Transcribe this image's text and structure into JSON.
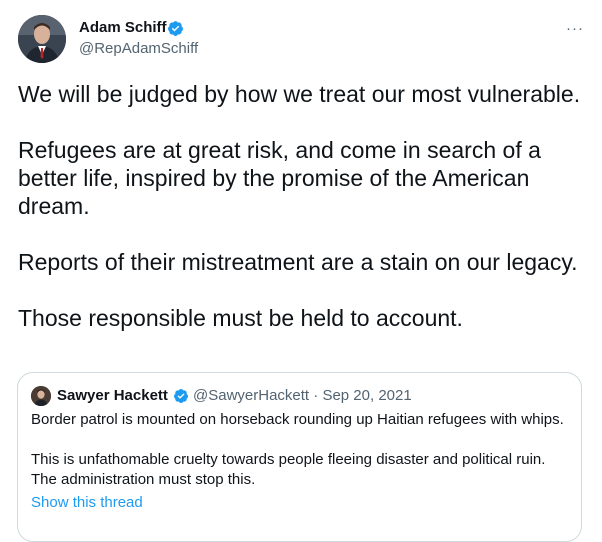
{
  "author": {
    "name": "Adam Schiff",
    "handle": "@RepAdamSchiff",
    "avatar_icon": "profile-photo",
    "verified_icon": "verified-badge-icon"
  },
  "more_label": "···",
  "tweet": {
    "paragraphs": [
      "We will be judged by how we treat our most vulnerable.",
      "Refugees are at great risk, and come in search of a better life, inspired by the promise of the American dream.",
      "Reports of their mistreatment are a stain on our legacy.",
      "Those responsible must be held to account."
    ]
  },
  "quoted": {
    "name": "Sawyer Hackett",
    "handle": "@SawyerHackett",
    "separator": "·",
    "date": "Sep 20, 2021",
    "paragraphs": [
      "Border patrol is mounted on horseback rounding up Haitian refugees with whips.",
      "This is unfathomable cruelty towards people fleeing disaster and political ruin. The administration must stop this."
    ],
    "show_thread": "Show this thread"
  },
  "colors": {
    "accent": "#1d9bf0",
    "secondary_text": "#536471",
    "border": "#cfd9de"
  }
}
